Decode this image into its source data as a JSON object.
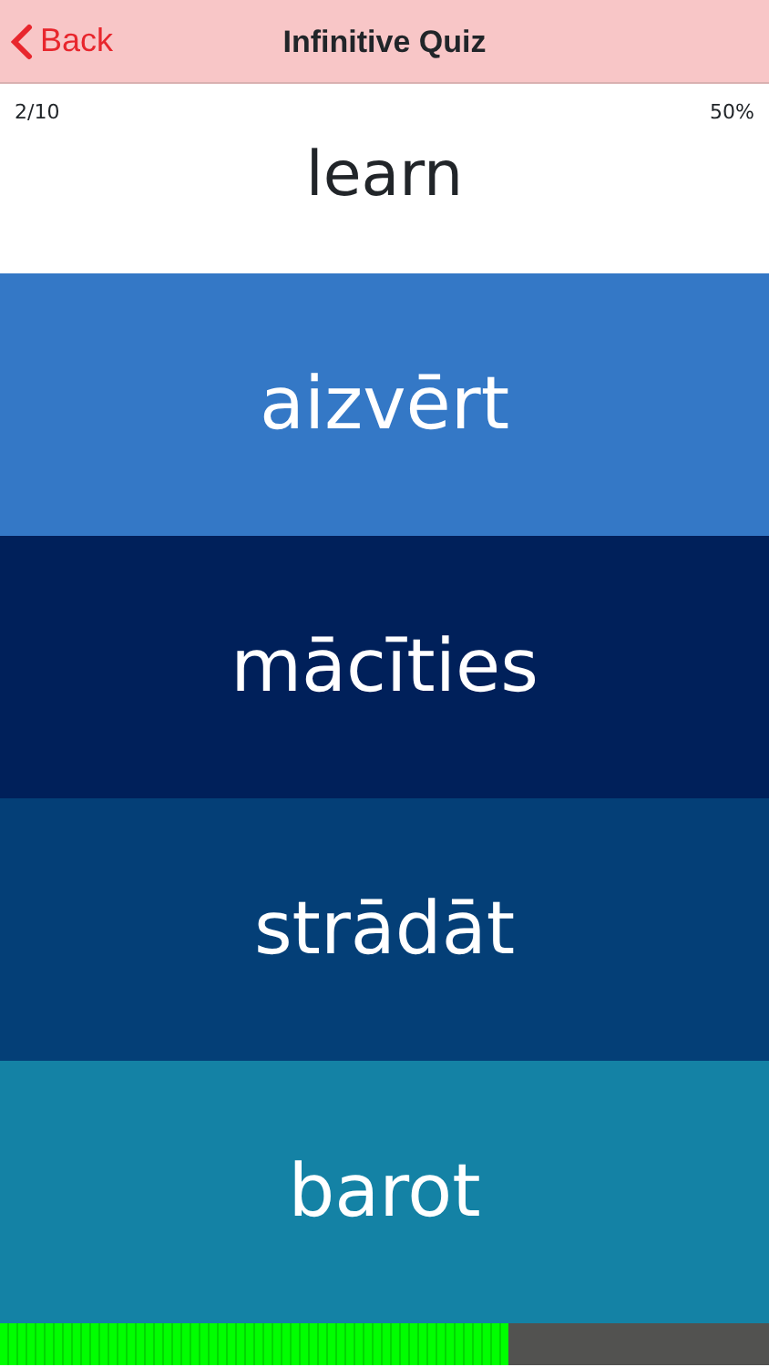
{
  "nav": {
    "back": "Back",
    "title": "Infinitive Quiz"
  },
  "progress_text": "2/10",
  "score": "50%",
  "question": "learn",
  "answers": [
    {
      "text": "aizvērt",
      "color": "#3478c6"
    },
    {
      "text": "mācīties",
      "color": "#00205a"
    },
    {
      "text": "strādāt",
      "color": "#043f77"
    },
    {
      "text": "barot",
      "color": "#1482a5"
    }
  ],
  "timer": {
    "level": 0.66
  }
}
